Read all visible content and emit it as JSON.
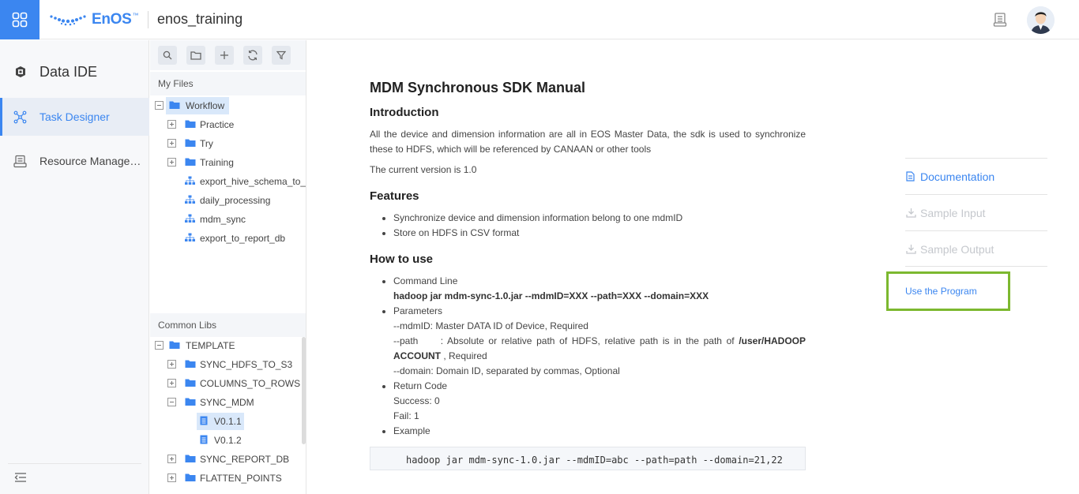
{
  "header": {
    "logo_text": "EnOS",
    "logo_tm": "™",
    "workspace": "enos_training"
  },
  "leftnav": {
    "title": "Data IDE",
    "items": [
      {
        "label": "Task Designer",
        "active": true
      },
      {
        "label": "Resource Management",
        "active": false
      }
    ]
  },
  "tree": {
    "my_files_label": "My Files",
    "my_files": [
      {
        "label": "Workflow",
        "type": "folder",
        "toggle": "minus",
        "selected": true
      },
      {
        "label": "Practice",
        "type": "folder",
        "toggle": "plus"
      },
      {
        "label": "Try",
        "type": "folder",
        "toggle": "plus"
      },
      {
        "label": "Training",
        "type": "folder",
        "toggle": "plus"
      },
      {
        "label": "export_hive_schema_to_report",
        "type": "workflow"
      },
      {
        "label": "daily_processing",
        "type": "workflow"
      },
      {
        "label": "mdm_sync",
        "type": "workflow"
      },
      {
        "label": "export_to_report_db",
        "type": "workflow"
      }
    ],
    "common_libs_label": "Common Libs",
    "common_libs": [
      {
        "label": "TEMPLATE",
        "type": "folder",
        "toggle": "minus"
      },
      {
        "label": "SYNC_HDFS_TO_S3",
        "type": "folder",
        "toggle": "plus"
      },
      {
        "label": "COLUMNS_TO_ROWS",
        "type": "folder",
        "toggle": "plus"
      },
      {
        "label": "SYNC_MDM",
        "type": "folder",
        "toggle": "minus"
      },
      {
        "label": "V0.1.1",
        "type": "file",
        "selected": true
      },
      {
        "label": "V0.1.2",
        "type": "file"
      },
      {
        "label": "SYNC_REPORT_DB",
        "type": "folder",
        "toggle": "plus"
      },
      {
        "label": "FLATTEN_POINTS",
        "type": "folder",
        "toggle": "plus"
      }
    ]
  },
  "doc": {
    "title": "MDM Synchronous SDK Manual",
    "intro_heading": "Introduction",
    "intro_text": "All the device and dimension information are all in EOS Master Data, the sdk is used to synchronize these to HDFS, which will be referenced by CANAAN or other tools",
    "version_text": "The current version is 1.0",
    "features_heading": "Features",
    "features": [
      "Synchronize device and dimension information belong to one mdmID",
      "Store on HDFS in CSV format"
    ],
    "howto_heading": "How to use",
    "cmd_label": "Command Line",
    "cmd": "hadoop jar mdm-sync-1.0.jar --mdmID=XXX --path=XXX --domain=XXX",
    "params_label": "Parameters",
    "param_mdmid": "--mdmID: Master DATA ID of Device, Required",
    "param_path_a": "--path     : Absolute or relative path of HDFS, relative path is in the path of ",
    "param_path_b": "/user/HADOOP ACCOUNT",
    "param_path_c": " , Required",
    "param_domain": "--domain: Domain ID, separated by commas, Optional",
    "return_label": "Return Code",
    "success": "Success: 0",
    "fail": "Fail: 1",
    "example_label": "Example",
    "example_code": "hadoop jar mdm-sync-1.0.jar --mdmID=abc --path=path --domain=21,22"
  },
  "rightnav": {
    "documentation": "Documentation",
    "sample_input": "Sample Input",
    "sample_output": "Sample Output",
    "use_program": "Use the Program"
  },
  "colors": {
    "accent": "#3b86f0",
    "highlight_border": "#7cb82f",
    "disabled": "#c5c8cd"
  }
}
